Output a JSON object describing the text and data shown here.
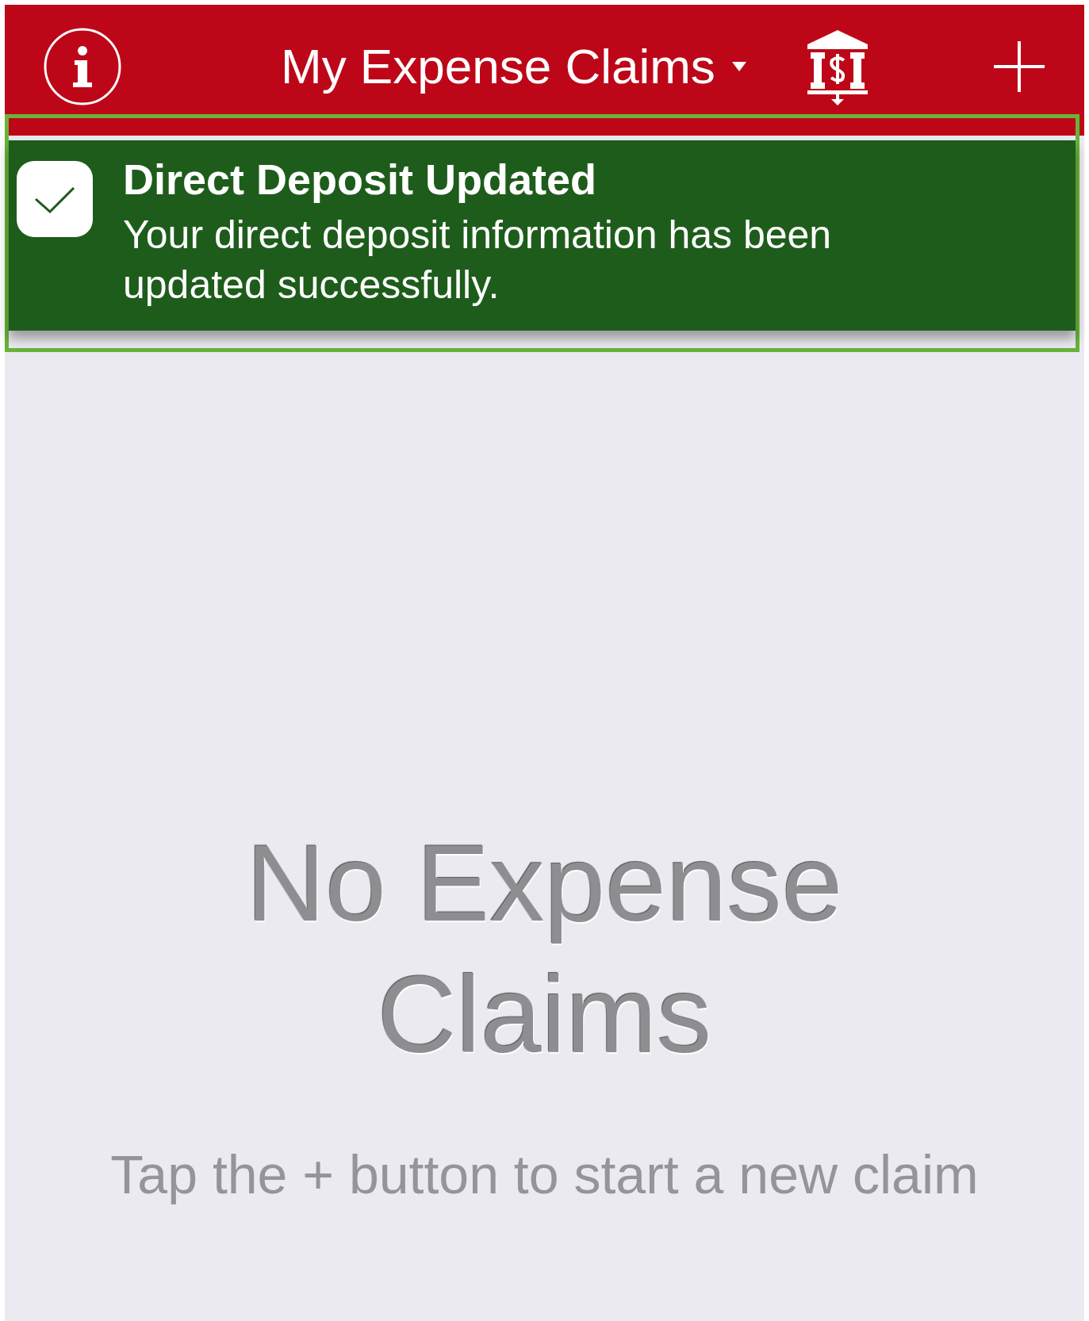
{
  "nav_bar": {
    "title": "My Expense Claims"
  },
  "toast": {
    "title": "Direct Deposit Updated",
    "message": "Your direct deposit information has been updated successfully.",
    "highlighted": true
  },
  "empty_state": {
    "title": "No Expense Claims",
    "hint": "Tap the + button to start a new claim"
  }
}
